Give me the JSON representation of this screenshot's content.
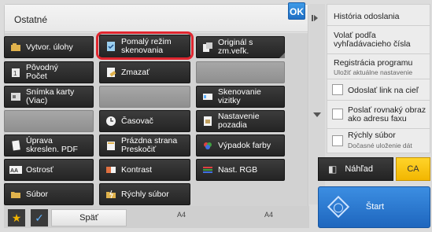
{
  "panel": {
    "title": "Ostatné",
    "ok_label": "OK"
  },
  "functions": [
    {
      "label": "Vytvor. úlohy",
      "icon": "job-build-icon",
      "enabled": true
    },
    {
      "label": "Pomalý režim\nskenovania",
      "icon": "slow-scan-icon",
      "enabled": true,
      "highlighted": true
    },
    {
      "label": "Originál s\nzm.veľk.",
      "icon": "mixed-size-original-icon",
      "enabled": true
    },
    {
      "label": "Pôvodný\nPočet",
      "icon": "original-count-icon",
      "enabled": true
    },
    {
      "label": "Zmazať",
      "icon": "erase-icon",
      "enabled": true
    },
    {
      "label": "",
      "icon": "",
      "enabled": false
    },
    {
      "label": "Snímka karty\n(Viac)",
      "icon": "card-shot-icon",
      "enabled": true
    },
    {
      "label": "",
      "icon": "",
      "enabled": false
    },
    {
      "label": "Skenovanie\nvizitky",
      "icon": "business-card-scan-icon",
      "enabled": true
    },
    {
      "label": "",
      "icon": "",
      "enabled": false
    },
    {
      "label": "Časovač",
      "icon": "timer-icon",
      "enabled": true
    },
    {
      "label": "Nastavenie\npozadia",
      "icon": "background-setting-icon",
      "enabled": true
    },
    {
      "label": "Úprava\nskreslen. PDF",
      "icon": "pdf-skew-icon",
      "enabled": true
    },
    {
      "label": "Prázdna strana\nPreskočiť",
      "icon": "blank-page-skip-icon",
      "enabled": true
    },
    {
      "label": "Výpadok farby",
      "icon": "color-dropout-icon",
      "enabled": true
    },
    {
      "label": "Ostrosť",
      "icon": "sharpness-icon",
      "enabled": true
    },
    {
      "label": "Kontrast",
      "icon": "contrast-icon",
      "enabled": true
    },
    {
      "label": "Nast. RGB",
      "icon": "rgb-adjust-icon",
      "enabled": true
    },
    {
      "label": "Súbor",
      "icon": "file-folder-icon",
      "enabled": true
    },
    {
      "label": "Rýchly súbor",
      "icon": "quick-file-icon",
      "enabled": true
    }
  ],
  "bottom": {
    "back_label": "Späť",
    "paper_left": "A4",
    "paper_right": "A4"
  },
  "right_panel": {
    "history": "História odoslania",
    "recall_number": "Volať podľa\nvyhľadávacieho čísla",
    "program_title": "Registrácia programu",
    "program_sub": "Uložiť aktuálne nastavenie",
    "send_link": "Odoslať link na cieľ",
    "send_same": "Poslať rovnaký obraz\nako adresu faxu",
    "quick_file_title": "Rýchly súbor",
    "quick_file_sub": "Dočasné uloženie dát"
  },
  "actions": {
    "preview_label": "Náhľad",
    "ca_label": "CA",
    "start_label": "Štart"
  },
  "colors": {
    "accent_blue": "#1e66be",
    "highlight_red": "#e0262f",
    "ca_yellow": "#f2b600",
    "button_dark": "#2e2e2e"
  }
}
